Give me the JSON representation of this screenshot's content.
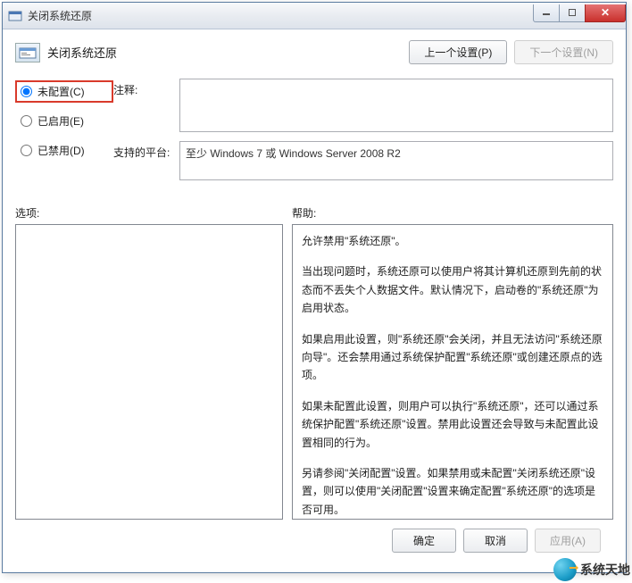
{
  "window": {
    "title": "关闭系统还原"
  },
  "header": {
    "title": "关闭系统还原",
    "prev_button": "上一个设置(P)",
    "next_button": "下一个设置(N)"
  },
  "radios": {
    "not_configured": "未配置(C)",
    "enabled": "已启用(E)",
    "disabled": "已禁用(D)",
    "selected": "not_configured"
  },
  "fields": {
    "comment_label": "注释:",
    "comment_value": "",
    "platform_label": "支持的平台:",
    "platform_value": "至少 Windows 7 或 Windows Server 2008 R2"
  },
  "panes": {
    "options_label": "选项:",
    "help_label": "帮助:",
    "help_paragraphs": [
      "允许禁用\"系统还原\"。",
      "当出现问题时，系统还原可以使用户将其计算机还原到先前的状态而不丢失个人数据文件。默认情况下，启动卷的\"系统还原\"为启用状态。",
      "如果启用此设置，则\"系统还原\"会关闭，并且无法访问\"系统还原向导\"。还会禁用通过系统保护配置\"系统还原\"或创建还原点的选项。",
      "如果未配置此设置，则用户可以执行\"系统还原\"，还可以通过系统保护配置\"系统还原\"设置。禁用此设置还会导致与未配置此设置相同的行为。",
      "另请参阅\"关闭配置\"设置。如果禁用或未配置\"关闭系统还原\"设置，则可以使用\"关闭配置\"设置来确定配置\"系统还原\"的选项是否可用。"
    ]
  },
  "footer": {
    "ok": "确定",
    "cancel": "取消",
    "apply": "应用(A)"
  },
  "watermark": {
    "text": "系统天地"
  }
}
